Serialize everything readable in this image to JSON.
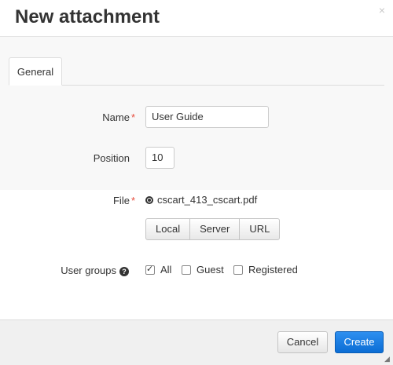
{
  "dialog": {
    "title": "New attachment",
    "close_icon": "×"
  },
  "tabs": [
    {
      "label": "General"
    }
  ],
  "form": {
    "name": {
      "label": "Name",
      "required_mark": "*",
      "value": "User Guide"
    },
    "position": {
      "label": "Position",
      "value": "10"
    },
    "file": {
      "label": "File",
      "required_mark": "*",
      "filename": "cscart_413_cscart.pdf",
      "sources": [
        "Local",
        "Server",
        "URL"
      ]
    },
    "user_groups": {
      "label": "User groups",
      "help_icon": "?",
      "options": [
        {
          "label": "All",
          "checked": true
        },
        {
          "label": "Guest",
          "checked": false
        },
        {
          "label": "Registered",
          "checked": false
        }
      ]
    }
  },
  "footer": {
    "cancel_label": "Cancel",
    "create_label": "Create"
  },
  "colors": {
    "primary": "#0b6dd4",
    "required": "#e74c3c"
  }
}
